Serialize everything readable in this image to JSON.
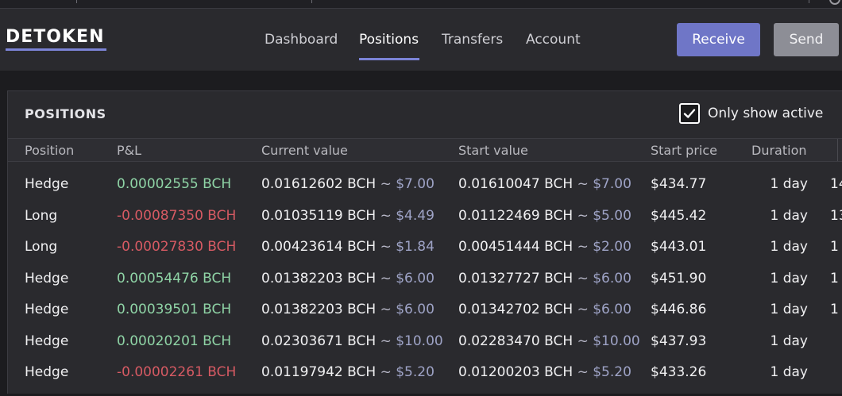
{
  "app": {
    "logo": "DETOKEN"
  },
  "nav": {
    "items": [
      {
        "label": "Dashboard"
      },
      {
        "label": "Positions"
      },
      {
        "label": "Transfers"
      },
      {
        "label": "Account"
      }
    ],
    "active": "Positions"
  },
  "actions": {
    "receive_label": "Receive",
    "send_label": "Send"
  },
  "colors": {
    "accent": "#6f76c7",
    "profit": "#8fd4a6",
    "loss": "#d65a63",
    "usd": "#9ea3c6"
  },
  "panel": {
    "title": "POSITIONS",
    "only_active_label": "Only show active",
    "only_active_checked": true
  },
  "table": {
    "headers": [
      "Position",
      "P&L",
      "Current value",
      "Start value",
      "Start price",
      "Duration"
    ],
    "rows": [
      {
        "position": "Hedge",
        "pnl": "0.00002555 BCH",
        "pnl_sign": "pos",
        "current_bch": "0.01612602 BCH",
        "current_usd": "$7.00",
        "start_bch": "0.01610047 BCH",
        "start_usd": "$7.00",
        "start_price": "$434.77",
        "duration": "1 day",
        "overflow": "14"
      },
      {
        "position": "Long",
        "pnl": "-0.00087350 BCH",
        "pnl_sign": "neg",
        "current_bch": "0.01035119 BCH",
        "current_usd": "$4.49",
        "start_bch": "0.01122469 BCH",
        "start_usd": "$5.00",
        "start_price": "$445.42",
        "duration": "1 day",
        "overflow": "13"
      },
      {
        "position": "Long",
        "pnl": "-0.00027830 BCH",
        "pnl_sign": "neg",
        "current_bch": "0.00423614 BCH",
        "current_usd": "$1.84",
        "start_bch": "0.00451444 BCH",
        "start_usd": "$2.00",
        "start_price": "$443.01",
        "duration": "1 day",
        "overflow": "1"
      },
      {
        "position": "Hedge",
        "pnl": "0.00054476 BCH",
        "pnl_sign": "pos",
        "current_bch": "0.01382203 BCH",
        "current_usd": "$6.00",
        "start_bch": "0.01327727 BCH",
        "start_usd": "$6.00",
        "start_price": "$451.90",
        "duration": "1 day",
        "overflow": "1"
      },
      {
        "position": "Hedge",
        "pnl": "0.00039501 BCH",
        "pnl_sign": "pos",
        "current_bch": "0.01382203 BCH",
        "current_usd": "$6.00",
        "start_bch": "0.01342702 BCH",
        "start_usd": "$6.00",
        "start_price": "$446.86",
        "duration": "1 day",
        "overflow": "1"
      },
      {
        "position": "Hedge",
        "pnl": "0.00020201 BCH",
        "pnl_sign": "pos",
        "current_bch": "0.02303671 BCH",
        "current_usd": "$10.00",
        "start_bch": "0.02283470 BCH",
        "start_usd": "$10.00",
        "start_price": "$437.93",
        "duration": "1 day",
        "overflow": ""
      },
      {
        "position": "Hedge",
        "pnl": "-0.00002261 BCH",
        "pnl_sign": "neg",
        "current_bch": "0.01197942 BCH",
        "current_usd": "$5.20",
        "start_bch": "0.01200203 BCH",
        "start_usd": "$5.20",
        "start_price": "$433.26",
        "duration": "1 day",
        "overflow": ""
      }
    ]
  }
}
